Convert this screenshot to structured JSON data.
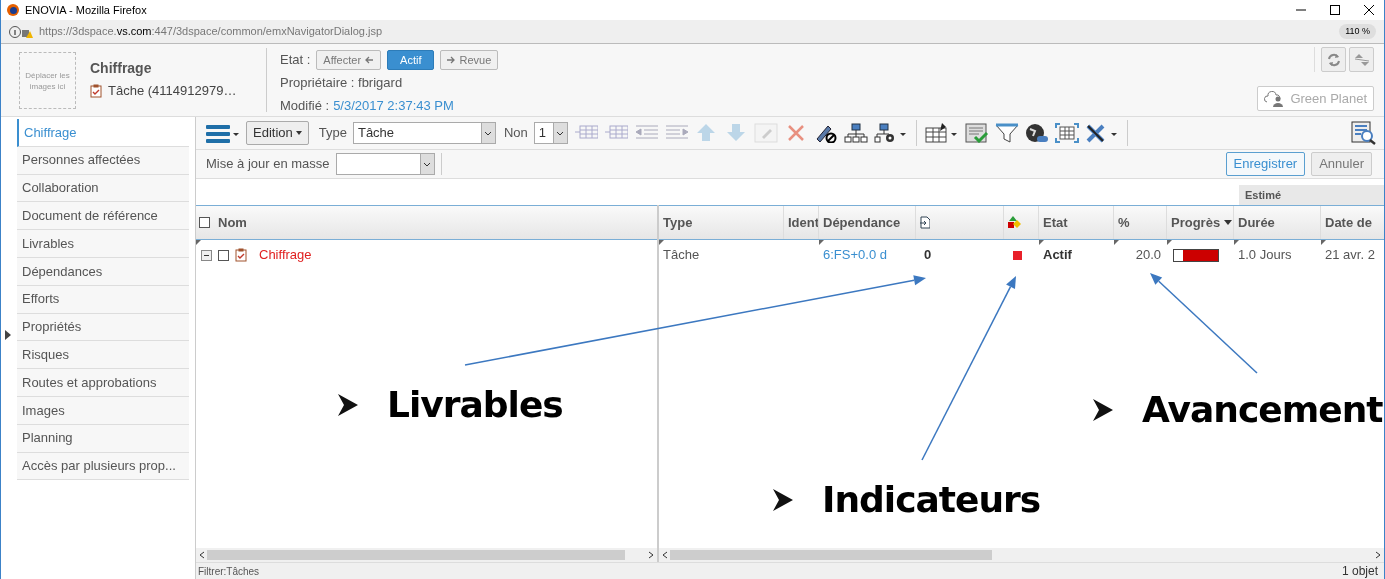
{
  "window": {
    "title": "ENOVIA - Mozilla Firefox",
    "url_prefix": "https://3dspace.",
    "url_domain": "vs.com",
    "url_rest": ":447/3dspace/common/emxNavigatorDialog.jsp",
    "zoom": "110 %"
  },
  "header": {
    "image_drop": "Déplacer les images ici",
    "title": "Chiffrage",
    "subtitle": "Tâche (4114912979…",
    "state_label": "Etat :",
    "state_buttons": [
      {
        "label": "Affecter",
        "kind": "prev",
        "selected": false
      },
      {
        "label": "Actif",
        "kind": "current",
        "selected": true
      },
      {
        "label": "Revue",
        "kind": "next",
        "selected": false
      }
    ],
    "owner": "Propriétaire : fbrigard",
    "modified_label": "Modifié :",
    "modified_value": "5/3/2017 2:37:43 PM",
    "brand_button": "Green Planet"
  },
  "sidebar": {
    "items": [
      {
        "label": "Chiffrage",
        "selected": true
      },
      {
        "label": "Personnes affectées",
        "selected": false
      },
      {
        "label": "Collaboration",
        "selected": false
      },
      {
        "label": "Document de référence",
        "selected": false
      },
      {
        "label": "Livrables",
        "selected": false
      },
      {
        "label": "Dépendances",
        "selected": false
      },
      {
        "label": "Efforts",
        "selected": false
      },
      {
        "label": "Propriétés",
        "selected": false
      },
      {
        "label": "Risques",
        "selected": false
      },
      {
        "label": "Routes et approbations",
        "selected": false
      },
      {
        "label": "Images",
        "selected": false
      },
      {
        "label": "Planning",
        "selected": false
      },
      {
        "label": "Accès par plusieurs prop...",
        "selected": false
      }
    ]
  },
  "toolbar": {
    "edit_menu": "Edition",
    "type_label": "Type",
    "type_value": "Tâche",
    "level_label": "Non",
    "level_value": "1",
    "mass_update_label": "Mise à jour en masse",
    "save": "Enregistrer",
    "cancel": "Annuler"
  },
  "table": {
    "group_header": "Estimé",
    "name_column": "Nom",
    "select_all_checked": false,
    "columns": [
      {
        "kind": "text",
        "label": "Type"
      },
      {
        "kind": "text",
        "label": "Ident"
      },
      {
        "kind": "text",
        "label": "Dépendance"
      },
      {
        "kind": "icon"
      },
      {
        "kind": "icon"
      },
      {
        "kind": "text",
        "label": "Etat"
      },
      {
        "kind": "text",
        "label": "%"
      },
      {
        "kind": "sort",
        "label": "Progrès"
      },
      {
        "kind": "text",
        "label": "Durée"
      },
      {
        "kind": "text",
        "label": "Date de"
      }
    ],
    "rows": [
      {
        "name": "Chiffrage",
        "expanded": true,
        "checked": false,
        "type": "Tâche",
        "dependency": "6:FS+0.0 d",
        "deliverables": "0",
        "color": "#e8202a",
        "state": "Actif",
        "percent": "20.0",
        "progress": {
          "level": 0.2
        },
        "duration": "1.0 Jours",
        "date": "21 avr. 2"
      }
    ]
  },
  "status_bar": {
    "filter": "Filtrer:Tâches",
    "count": "1 objet"
  },
  "annotations": [
    {
      "label": "Livrables"
    },
    {
      "label": "Indicateurs"
    },
    {
      "label": "Avancement"
    }
  ]
}
